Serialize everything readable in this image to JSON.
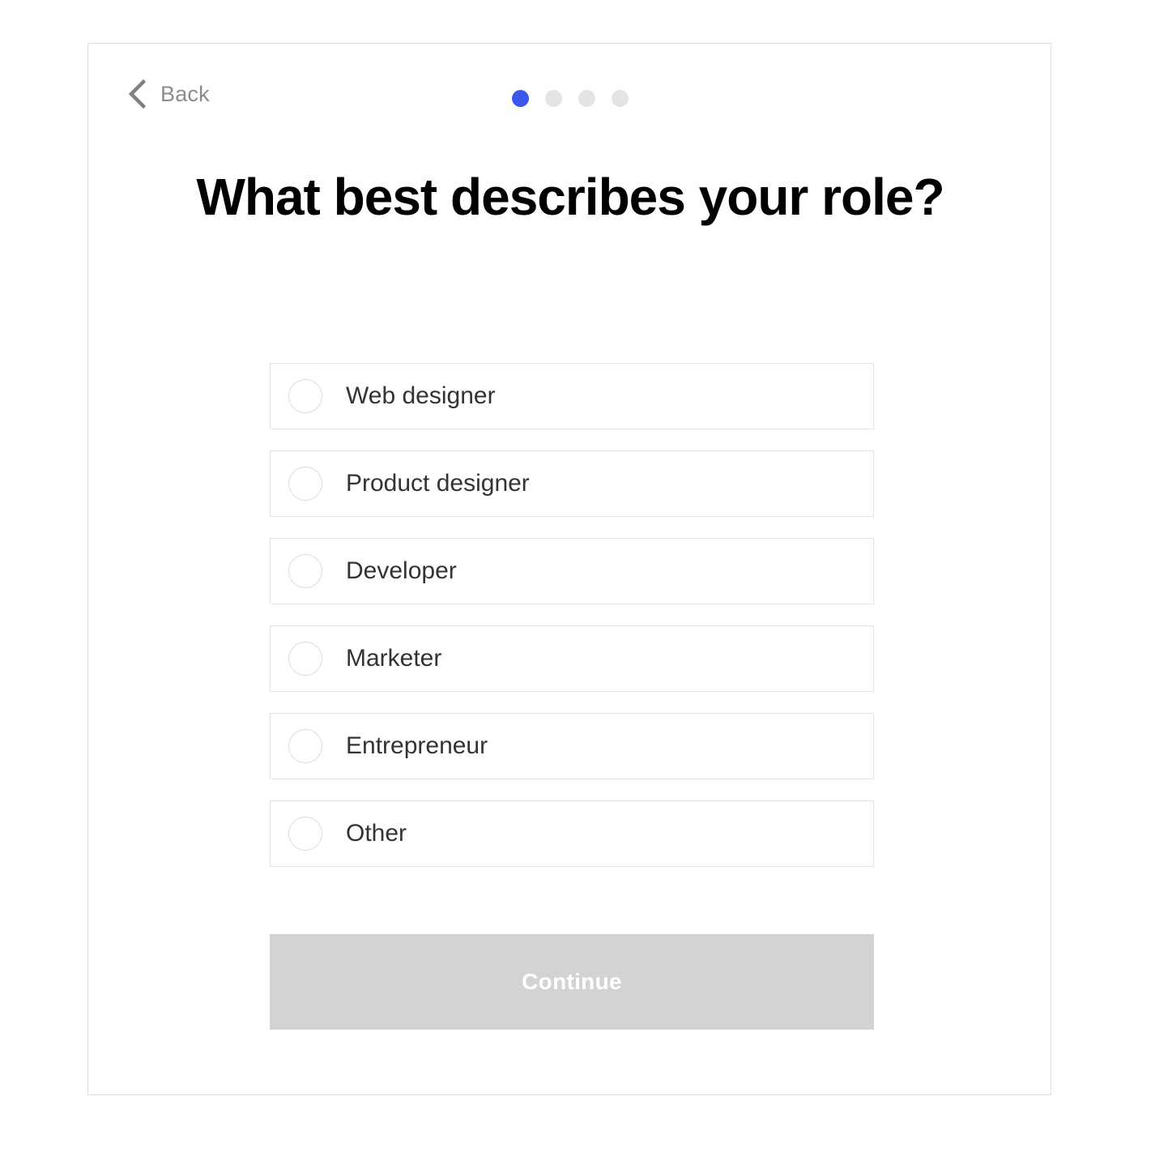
{
  "nav": {
    "back_label": "Back",
    "back_icon": "chevron-left-icon"
  },
  "progress": {
    "total_steps": 4,
    "current_step": 1,
    "active_color": "#3b57ee",
    "inactive_color": "#e4e4e6"
  },
  "main": {
    "heading": "What best describes your role?",
    "options": [
      {
        "label": "Web designer",
        "selected": false
      },
      {
        "label": "Product designer",
        "selected": false
      },
      {
        "label": "Developer",
        "selected": false
      },
      {
        "label": "Marketer",
        "selected": false
      },
      {
        "label": "Entrepreneur",
        "selected": false
      },
      {
        "label": "Other",
        "selected": false
      }
    ]
  },
  "footer": {
    "continue_label": "Continue",
    "continue_disabled": true,
    "continue_bg": "#d2d3d5",
    "continue_text_color": "#ffffff"
  }
}
